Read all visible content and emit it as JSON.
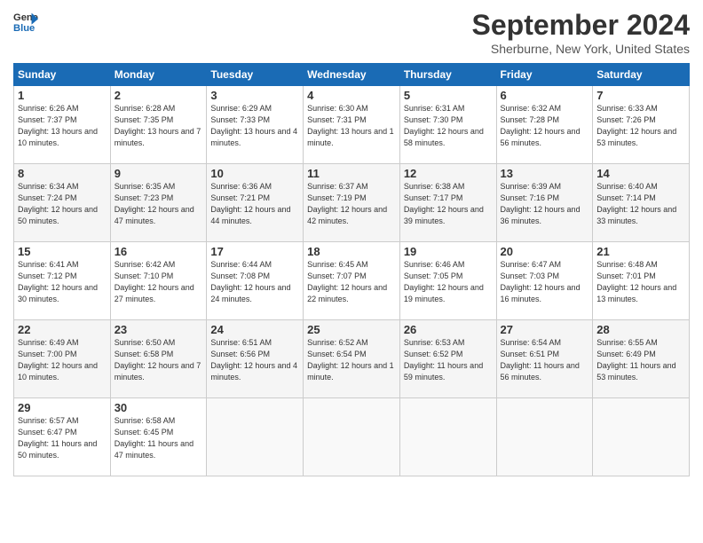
{
  "logo": {
    "line1": "General",
    "line2": "Blue"
  },
  "title": "September 2024",
  "location": "Sherburne, New York, United States",
  "days_header": [
    "Sunday",
    "Monday",
    "Tuesday",
    "Wednesday",
    "Thursday",
    "Friday",
    "Saturday"
  ],
  "weeks": [
    [
      {
        "day": "1",
        "sunrise": "6:26 AM",
        "sunset": "7:37 PM",
        "daylight": "13 hours and 10 minutes."
      },
      {
        "day": "2",
        "sunrise": "6:28 AM",
        "sunset": "7:35 PM",
        "daylight": "13 hours and 7 minutes."
      },
      {
        "day": "3",
        "sunrise": "6:29 AM",
        "sunset": "7:33 PM",
        "daylight": "13 hours and 4 minutes."
      },
      {
        "day": "4",
        "sunrise": "6:30 AM",
        "sunset": "7:31 PM",
        "daylight": "13 hours and 1 minute."
      },
      {
        "day": "5",
        "sunrise": "6:31 AM",
        "sunset": "7:30 PM",
        "daylight": "12 hours and 58 minutes."
      },
      {
        "day": "6",
        "sunrise": "6:32 AM",
        "sunset": "7:28 PM",
        "daylight": "12 hours and 56 minutes."
      },
      {
        "day": "7",
        "sunrise": "6:33 AM",
        "sunset": "7:26 PM",
        "daylight": "12 hours and 53 minutes."
      }
    ],
    [
      {
        "day": "8",
        "sunrise": "6:34 AM",
        "sunset": "7:24 PM",
        "daylight": "12 hours and 50 minutes."
      },
      {
        "day": "9",
        "sunrise": "6:35 AM",
        "sunset": "7:23 PM",
        "daylight": "12 hours and 47 minutes."
      },
      {
        "day": "10",
        "sunrise": "6:36 AM",
        "sunset": "7:21 PM",
        "daylight": "12 hours and 44 minutes."
      },
      {
        "day": "11",
        "sunrise": "6:37 AM",
        "sunset": "7:19 PM",
        "daylight": "12 hours and 42 minutes."
      },
      {
        "day": "12",
        "sunrise": "6:38 AM",
        "sunset": "7:17 PM",
        "daylight": "12 hours and 39 minutes."
      },
      {
        "day": "13",
        "sunrise": "6:39 AM",
        "sunset": "7:16 PM",
        "daylight": "12 hours and 36 minutes."
      },
      {
        "day": "14",
        "sunrise": "6:40 AM",
        "sunset": "7:14 PM",
        "daylight": "12 hours and 33 minutes."
      }
    ],
    [
      {
        "day": "15",
        "sunrise": "6:41 AM",
        "sunset": "7:12 PM",
        "daylight": "12 hours and 30 minutes."
      },
      {
        "day": "16",
        "sunrise": "6:42 AM",
        "sunset": "7:10 PM",
        "daylight": "12 hours and 27 minutes."
      },
      {
        "day": "17",
        "sunrise": "6:44 AM",
        "sunset": "7:08 PM",
        "daylight": "12 hours and 24 minutes."
      },
      {
        "day": "18",
        "sunrise": "6:45 AM",
        "sunset": "7:07 PM",
        "daylight": "12 hours and 22 minutes."
      },
      {
        "day": "19",
        "sunrise": "6:46 AM",
        "sunset": "7:05 PM",
        "daylight": "12 hours and 19 minutes."
      },
      {
        "day": "20",
        "sunrise": "6:47 AM",
        "sunset": "7:03 PM",
        "daylight": "12 hours and 16 minutes."
      },
      {
        "day": "21",
        "sunrise": "6:48 AM",
        "sunset": "7:01 PM",
        "daylight": "12 hours and 13 minutes."
      }
    ],
    [
      {
        "day": "22",
        "sunrise": "6:49 AM",
        "sunset": "7:00 PM",
        "daylight": "12 hours and 10 minutes."
      },
      {
        "day": "23",
        "sunrise": "6:50 AM",
        "sunset": "6:58 PM",
        "daylight": "12 hours and 7 minutes."
      },
      {
        "day": "24",
        "sunrise": "6:51 AM",
        "sunset": "6:56 PM",
        "daylight": "12 hours and 4 minutes."
      },
      {
        "day": "25",
        "sunrise": "6:52 AM",
        "sunset": "6:54 PM",
        "daylight": "12 hours and 1 minute."
      },
      {
        "day": "26",
        "sunrise": "6:53 AM",
        "sunset": "6:52 PM",
        "daylight": "11 hours and 59 minutes."
      },
      {
        "day": "27",
        "sunrise": "6:54 AM",
        "sunset": "6:51 PM",
        "daylight": "11 hours and 56 minutes."
      },
      {
        "day": "28",
        "sunrise": "6:55 AM",
        "sunset": "6:49 PM",
        "daylight": "11 hours and 53 minutes."
      }
    ],
    [
      {
        "day": "29",
        "sunrise": "6:57 AM",
        "sunset": "6:47 PM",
        "daylight": "11 hours and 50 minutes."
      },
      {
        "day": "30",
        "sunrise": "6:58 AM",
        "sunset": "6:45 PM",
        "daylight": "11 hours and 47 minutes."
      },
      null,
      null,
      null,
      null,
      null
    ]
  ]
}
